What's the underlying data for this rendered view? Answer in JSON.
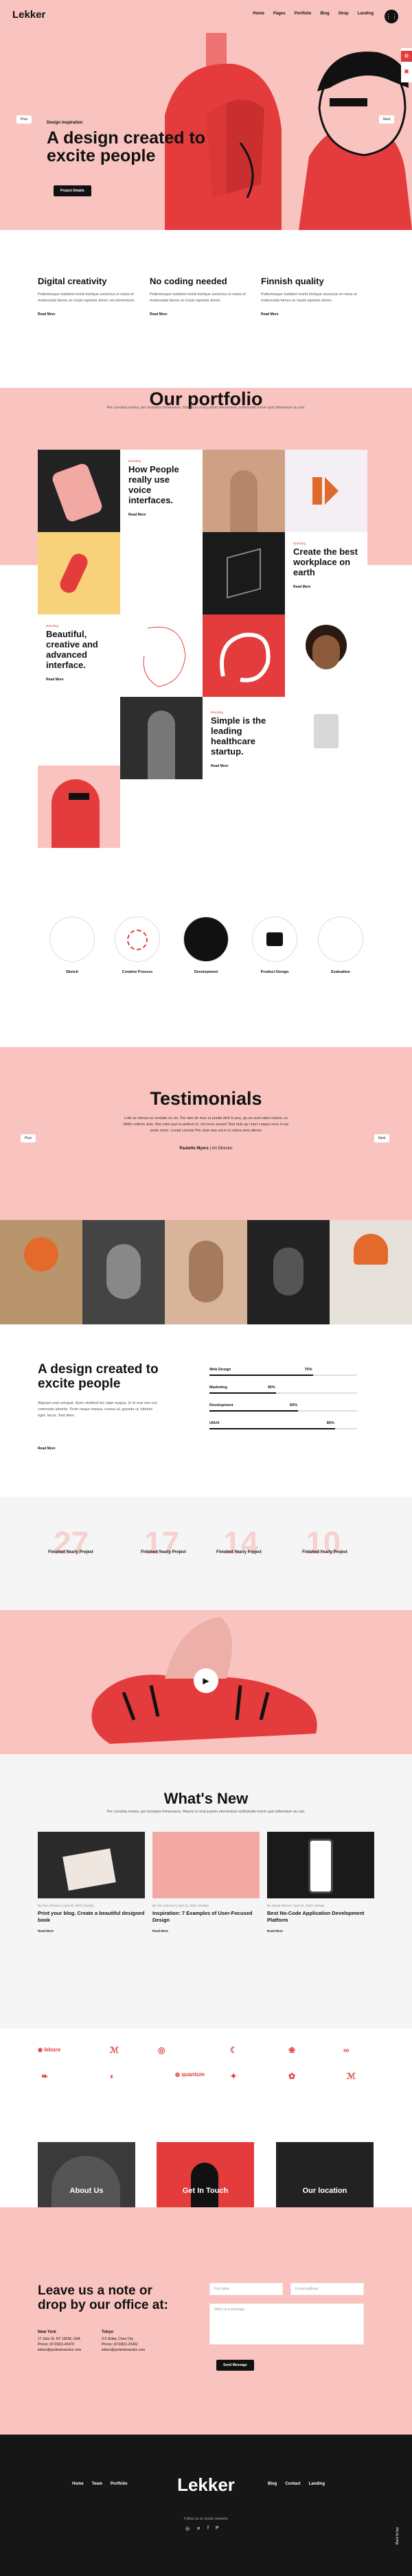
{
  "header": {
    "logo": "Lekker",
    "nav": [
      "Home",
      "Pages",
      "Portfolio",
      "Blog",
      "Shop",
      "Landing"
    ],
    "menu_icon": "grid-icon"
  },
  "hero": {
    "prev": "Prev",
    "next": "Next",
    "kicker": "Design inspiration",
    "title": "A design created to excite people",
    "button": "Project Details"
  },
  "features": [
    {
      "title": "Digital creativity",
      "text": "Pellentesque habitant morbi tristique senectus et netus et malesuada fames ac turpis egestas donec vel elementum.",
      "more": "Read More"
    },
    {
      "title": "No coding needed",
      "text": "Pellentesque habitant morbi tristique senectus et netus et malesuada fames ac turpis egestas donec.",
      "more": "Read More"
    },
    {
      "title": "Finnish quality",
      "text": "Pellentesque habitant morbi tristique senectus et netus et malesuada fames ac turpis egestas donec.",
      "more": "Read More"
    }
  ],
  "portfolio": {
    "title": "Our portfolio",
    "intro": "Per conubia nostra, per inceptos himenaeos. Mauris in erat justom elementum sollicitudin lorem quis bibendum au nisi.",
    "tiles": [
      {
        "cat": "Branding",
        "title": "How People really use voice interfaces.",
        "more": "Read More"
      },
      {
        "cat": "Branding",
        "title": "Create the best workplace on earth",
        "more": "Read More"
      },
      {
        "cat": "Branding",
        "title": "Beautiful, creative and advanced interface.",
        "more": "Read More"
      },
      {
        "cat": "Branding",
        "title": "Simple is the leading healthcare startup.",
        "more": "Read More"
      }
    ]
  },
  "services": [
    "Sketch",
    "Creative Process",
    "Development",
    "Product Design",
    "Evaluation"
  ],
  "testimonials": {
    "title": "Testimonials",
    "quote": "Lobi ne mimus ex veritate ex vis. Per tam de mus ut posita dicit in pus, qu eo sunt rateri metus, cu fallito cellens duis. Nec odot que tu pottum in, vix luces serani! Sed duis qu i tam t saqui voce in lus proto more. Leniat conuta! Per dum sea est in tu utima sem sileren",
    "author": "Paulette Myers",
    "role": "Art Director",
    "prev": "Prev",
    "next": "Next"
  },
  "skills": {
    "title": "A design created to excite people",
    "text": "Aliquam erat volutpat. Nunc eleifend leo vitae magna. In id erat non orci commodo lobortis. Proin neque massa, cursus ut, gravida ut, lobortis eget, lacus. Sed diam.",
    "more": "Read More",
    "bars": [
      {
        "name": "Web Design",
        "pct": "70%",
        "value": 0.7
      },
      {
        "name": "Marketing",
        "pct": "45%",
        "value": 0.45
      },
      {
        "name": "Development",
        "pct": "60%",
        "value": 0.6
      },
      {
        "name": "UI/UX",
        "pct": "85%",
        "value": 0.85
      }
    ]
  },
  "counters": [
    {
      "num": "27",
      "label": "Finished Yearly Project"
    },
    {
      "num": "17",
      "label": "Finished Yearly Project"
    },
    {
      "num": "14",
      "label": "Finished Yearly Project"
    },
    {
      "num": "10",
      "label": "Finished Yearly Project"
    }
  ],
  "news": {
    "title": "What's New",
    "intro": "Per conubia nostra, per inceptos himenaeos. Mauris in erat justom elementum sollicitudin lorem quis bibendum au nisi.",
    "items": [
      {
        "meta": "By Tom Johnson | April 15, 2022 | Design",
        "title": "Print your blog. Create a beautiful designed book",
        "more": "Read More"
      },
      {
        "meta": "By Tom Johnson | April 15, 2022 | Design",
        "title": "Inspiration: 7 Examples of User-Focused Design",
        "more": "Read More"
      },
      {
        "meta": "By Jessie Ramos | April 15, 2022 | Design",
        "title": "Best No-Code Application Development Platform",
        "more": "Read More"
      }
    ]
  },
  "partners": [
    "lebore",
    "quantum"
  ],
  "info_cards": [
    "About Us",
    "Get In Touch",
    "Our location"
  ],
  "contact": {
    "title": "Leave us a note or drop by our office at:",
    "offices": [
      {
        "city": "New York",
        "line1": "17 John St, NY 10038, USA",
        "line2": "Phone: (672)821-45470",
        "line3": "lekker@qodeinteractive.com"
      },
      {
        "city": "Tokyo",
        "line1": "3-5 Shiba, Chuo City",
        "line2": "Phone: (672)821-25432",
        "line3": "lekker@qodeinteractive.com"
      }
    ],
    "name_ph": "Full name",
    "email_ph": "E-mail address",
    "msg_ph": "Write us a message...",
    "send": "Send Message"
  },
  "footer": {
    "links_left": [
      "Home",
      "Team",
      "Portfolio"
    ],
    "logo": "Lekker",
    "links_right": [
      "Blog",
      "Contact",
      "Landing"
    ],
    "social_label": "Follow us on social networks",
    "social_icons": [
      "instagram-icon",
      "twitter-icon",
      "facebook-icon",
      "pinterest-icon"
    ],
    "back_top": "Back to top"
  },
  "colors": {
    "pink": "#f9c4c0",
    "red": "#e43c3c",
    "dark": "#161616"
  }
}
